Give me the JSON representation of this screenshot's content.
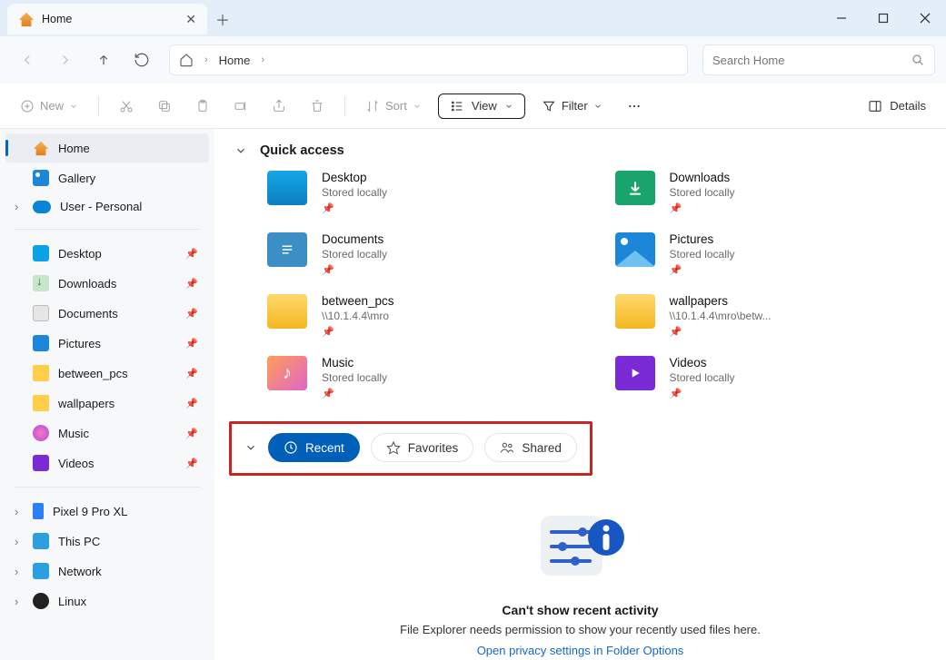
{
  "window": {
    "tab_title": "Home"
  },
  "nav": {
    "breadcrumb": "Home"
  },
  "search": {
    "placeholder": "Search Home"
  },
  "toolbar": {
    "new": "New",
    "sort": "Sort",
    "view": "View",
    "filter": "Filter",
    "details": "Details"
  },
  "sidebar": {
    "top": [
      {
        "label": "Home"
      },
      {
        "label": "Gallery"
      },
      {
        "label": "User - Personal"
      }
    ],
    "pinned": [
      {
        "label": "Desktop"
      },
      {
        "label": "Downloads"
      },
      {
        "label": "Documents"
      },
      {
        "label": "Pictures"
      },
      {
        "label": "between_pcs"
      },
      {
        "label": "wallpapers"
      },
      {
        "label": "Music"
      },
      {
        "label": "Videos"
      }
    ],
    "bottom": [
      {
        "label": "Pixel 9 Pro XL"
      },
      {
        "label": "This PC"
      },
      {
        "label": "Network"
      },
      {
        "label": "Linux"
      }
    ]
  },
  "quick_access": {
    "title": "Quick access",
    "items": [
      {
        "name": "Desktop",
        "sub": "Stored locally"
      },
      {
        "name": "Downloads",
        "sub": "Stored locally"
      },
      {
        "name": "Documents",
        "sub": "Stored locally"
      },
      {
        "name": "Pictures",
        "sub": "Stored locally"
      },
      {
        "name": "between_pcs",
        "sub": "\\\\10.1.4.4\\mro"
      },
      {
        "name": "wallpapers",
        "sub": "\\\\10.1.4.4\\mro\\betw..."
      },
      {
        "name": "Music",
        "sub": "Stored locally"
      },
      {
        "name": "Videos",
        "sub": "Stored locally"
      }
    ]
  },
  "recent_tabs": {
    "recent": "Recent",
    "favorites": "Favorites",
    "shared": "Shared"
  },
  "empty": {
    "title": "Can't show recent activity",
    "body": "File Explorer needs permission to show your recently used files here.",
    "link": "Open privacy settings in Folder Options"
  }
}
